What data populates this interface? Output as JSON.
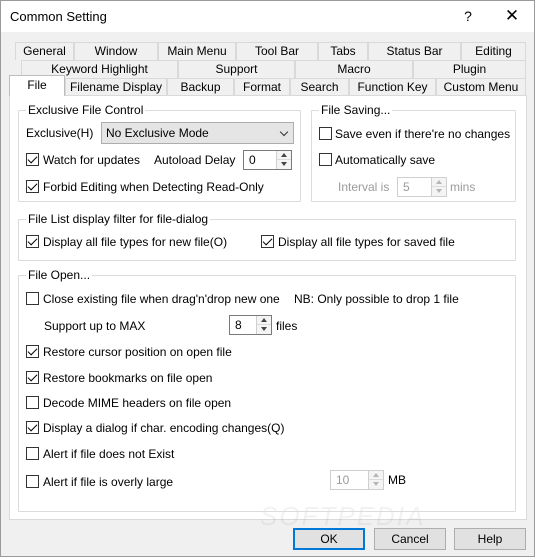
{
  "window": {
    "title": "Common Setting",
    "help": "?",
    "close": "✕"
  },
  "tabs": {
    "row1": [
      "General",
      "Window",
      "Main Menu",
      "Tool Bar",
      "Tabs",
      "Status Bar",
      "Editing"
    ],
    "row2": [
      "Keyword Highlight",
      "Support",
      "Macro",
      "Plugin"
    ],
    "row3": [
      "File",
      "Filename Display",
      "Backup",
      "Format",
      "Search",
      "Function Key",
      "Custom Menu"
    ]
  },
  "exclusive": {
    "group_label": "Exclusive File Control",
    "label": "Exclusive(H)",
    "mode": "No Exclusive Mode",
    "watch_label": "Watch for updates",
    "watch_checked": true,
    "autoload_label": "Autoload Delay",
    "autoload_value": "0",
    "forbid_label": "Forbid Editing when Detecting Read-Only",
    "forbid_checked": true
  },
  "saving": {
    "group_label": "File Saving...",
    "save_even_label": "Save even if there're no changes",
    "save_even_checked": false,
    "auto_save_label": "Automatically save",
    "auto_save_checked": false,
    "interval_label": "Interval is",
    "interval_value": "5",
    "interval_unit": "mins"
  },
  "filter": {
    "group_label": "File List display filter for file-dialog",
    "new_label": "Display all file types for new file(O)",
    "new_checked": true,
    "saved_label": "Display all file types for saved file",
    "saved_checked": true
  },
  "open": {
    "group_label": "File Open...",
    "close_existing_label": "Close existing file when drag'n'drop new one",
    "close_existing_checked": false,
    "nb_text": "NB: Only possible to drop 1 file",
    "support_label": "Support up to MAX",
    "support_value": "8",
    "support_unit": "files",
    "restore_cursor_label": "Restore cursor position on open file",
    "restore_cursor_checked": true,
    "restore_bookmarks_label": "Restore bookmarks on file open",
    "restore_bookmarks_checked": true,
    "decode_mime_label": "Decode MIME headers on file open",
    "decode_mime_checked": false,
    "display_dialog_label": "Display a dialog if char. encoding changes(Q)",
    "display_dialog_checked": true,
    "alert_not_exist_label": "Alert if file does not Exist",
    "alert_not_exist_checked": false,
    "alert_large_label": "Alert if file is overly large",
    "alert_large_checked": false,
    "large_value": "10",
    "large_unit": "MB"
  },
  "buttons": {
    "ok": "OK",
    "cancel": "Cancel",
    "help": "Help"
  },
  "colors": {
    "accent": "#0078d7",
    "disabled_text": "#9a9a9a"
  }
}
